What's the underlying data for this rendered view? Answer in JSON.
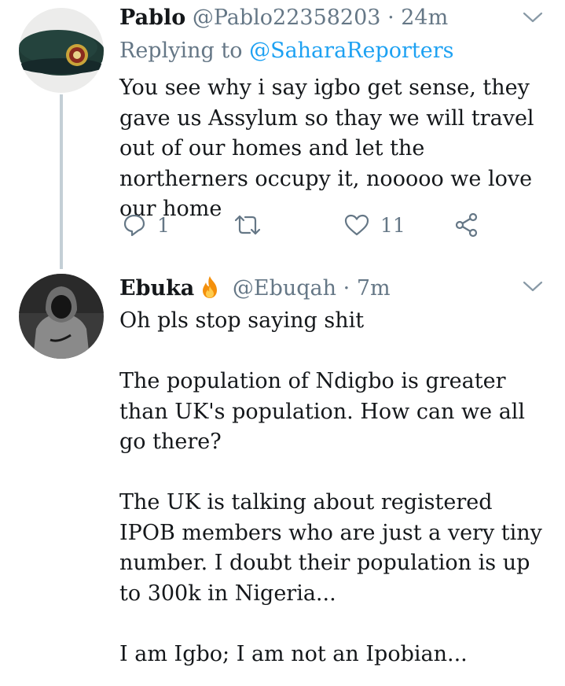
{
  "tweets": [
    {
      "name": "Pablo",
      "handle": "@Pablo22358203",
      "separator": "·",
      "time": "24m",
      "replying_prefix": "Replying to",
      "replying_to": "@SaharaReporters",
      "text": "You see why i say igbo get sense,  they gave us Assylum so thay we will travel out of our homes and let the northerners occupy it, nooooo we love our home",
      "reply_count": "1",
      "like_count": "11",
      "icons": [
        "reply-icon",
        "retweet-icon",
        "like-icon",
        "share-icon",
        "chevron-down-icon"
      ]
    },
    {
      "name": "Ebuka",
      "name_emoji": "fire-icon",
      "handle": "@Ebuqah",
      "separator": "·",
      "time": "7m",
      "paragraphs": [
        "Oh pls stop saying shit",
        "The population of Ndigbo is greater than UK's population. How can we all go there?",
        "The UK is talking about registered IPOB members who are just a very tiny number. I doubt their population is up to 300k in Nigeria...",
        "I am Igbo; I am not an Ipobian..."
      ]
    }
  ],
  "colors": {
    "text": "#14171a",
    "muted": "#657786",
    "link": "#1da1f2",
    "thread_line": "#c4cfd6"
  }
}
